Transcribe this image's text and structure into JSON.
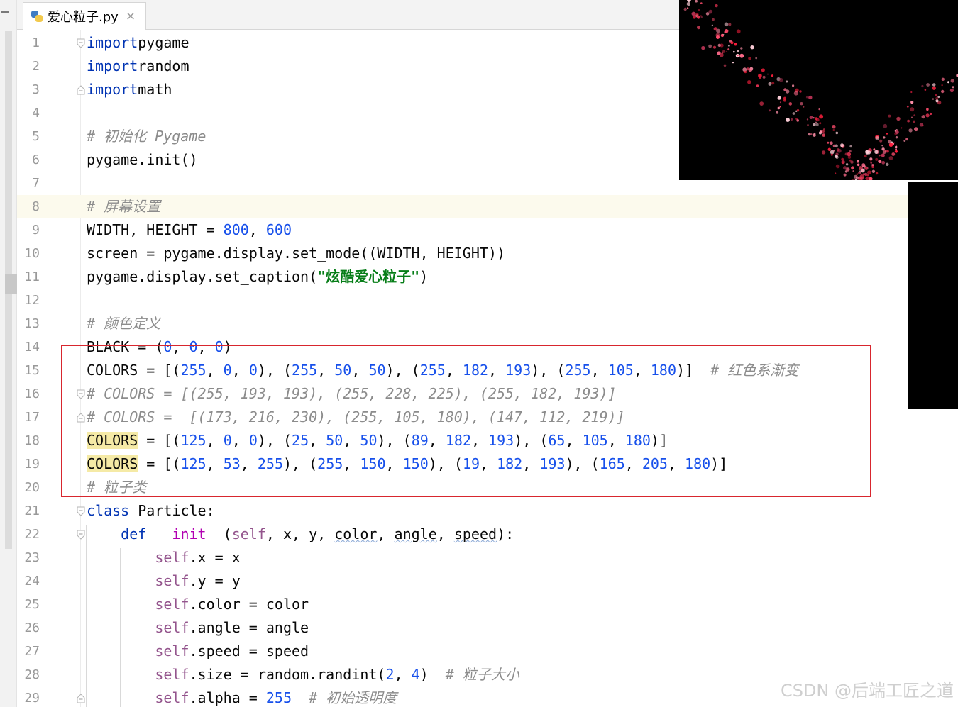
{
  "editor": {
    "tab": {
      "filename": "爱心粒子.py",
      "close": "×"
    },
    "watermark": "CSDN @后端工匠之道",
    "lines": [
      {
        "n": "1",
        "tokens": [
          [
            "kw",
            "import"
          ],
          [
            "",
            "pygame"
          ]
        ]
      },
      {
        "n": "2",
        "tokens": [
          [
            "kw",
            "import"
          ],
          [
            "",
            "random"
          ]
        ]
      },
      {
        "n": "3",
        "tokens": [
          [
            "kw",
            "import"
          ],
          [
            "",
            "math"
          ]
        ]
      },
      {
        "n": "4",
        "tokens": []
      },
      {
        "n": "5",
        "tokens": [
          [
            "cm",
            "# 初始化 Pygame"
          ]
        ]
      },
      {
        "n": "6",
        "tokens": [
          [
            "",
            "pygame.init()"
          ]
        ]
      },
      {
        "n": "7",
        "tokens": []
      },
      {
        "n": "8",
        "tokens": [
          [
            "cm",
            "# 屏幕设置"
          ]
        ],
        "current": true
      },
      {
        "n": "9",
        "tokens": [
          [
            "",
            "WIDTH, HEIGHT = "
          ],
          [
            "num",
            "800"
          ],
          [
            "",
            ", "
          ],
          [
            "num",
            "600"
          ]
        ]
      },
      {
        "n": "10",
        "tokens": [
          [
            "",
            "screen = pygame.display.set_mode((WIDTH, HEIGHT))"
          ]
        ]
      },
      {
        "n": "11",
        "tokens": [
          [
            "",
            "pygame.display.set_caption("
          ],
          [
            "str",
            "\"炫酷爱心粒子\""
          ],
          [
            "",
            ")"
          ]
        ]
      },
      {
        "n": "12",
        "tokens": []
      },
      {
        "n": "13",
        "tokens": [
          [
            "cm",
            "# 颜色定义"
          ]
        ]
      },
      {
        "n": "14",
        "tokens": [
          [
            "",
            "BLACK = ("
          ],
          [
            "num",
            "0"
          ],
          [
            "",
            ", "
          ],
          [
            "num",
            "0"
          ],
          [
            "",
            ", "
          ],
          [
            "num",
            "0"
          ],
          [
            "",
            ")"
          ]
        ]
      },
      {
        "n": "15",
        "tokens": [
          [
            "",
            "COLORS = [("
          ],
          [
            "num",
            "255"
          ],
          [
            "",
            ", "
          ],
          [
            "num",
            "0"
          ],
          [
            "",
            ", "
          ],
          [
            "num",
            "0"
          ],
          [
            "",
            "), ("
          ],
          [
            "num",
            "255"
          ],
          [
            "",
            ", "
          ],
          [
            "num",
            "50"
          ],
          [
            "",
            ", "
          ],
          [
            "num",
            "50"
          ],
          [
            "",
            "), ("
          ],
          [
            "num",
            "255"
          ],
          [
            "",
            ", "
          ],
          [
            "num",
            "182"
          ],
          [
            "",
            ", "
          ],
          [
            "num",
            "193"
          ],
          [
            "",
            "), ("
          ],
          [
            "num",
            "255"
          ],
          [
            "",
            ", "
          ],
          [
            "num",
            "105"
          ],
          [
            "",
            ", "
          ],
          [
            "num",
            "180"
          ],
          [
            "",
            ")]  "
          ],
          [
            "cm",
            "# 红色系渐变"
          ]
        ]
      },
      {
        "n": "16",
        "tokens": [
          [
            "cm",
            "# COLORS = [(255, 193, 193), (255, 228, 225), (255, 182, 193)]"
          ]
        ]
      },
      {
        "n": "17",
        "tokens": [
          [
            "cm",
            "# COLORS =  [(173, 216, 230), (255, 105, 180), (147, 112, 219)]"
          ]
        ]
      },
      {
        "n": "18",
        "tokens": [
          [
            "hl",
            "COLORS"
          ],
          [
            "",
            " = [("
          ],
          [
            "num",
            "125"
          ],
          [
            "",
            ", "
          ],
          [
            "num",
            "0"
          ],
          [
            "",
            ", "
          ],
          [
            "num",
            "0"
          ],
          [
            "",
            "), ("
          ],
          [
            "num",
            "25"
          ],
          [
            "",
            ", "
          ],
          [
            "num",
            "50"
          ],
          [
            "",
            ", "
          ],
          [
            "num",
            "50"
          ],
          [
            "",
            "), ("
          ],
          [
            "num",
            "89"
          ],
          [
            "",
            ", "
          ],
          [
            "num",
            "182"
          ],
          [
            "",
            ", "
          ],
          [
            "num",
            "193"
          ],
          [
            "",
            "), ("
          ],
          [
            "num",
            "65"
          ],
          [
            "",
            ", "
          ],
          [
            "num",
            "105"
          ],
          [
            "",
            ", "
          ],
          [
            "num",
            "180"
          ],
          [
            "",
            ")]"
          ]
        ]
      },
      {
        "n": "19",
        "tokens": [
          [
            "hl",
            "COLORS"
          ],
          [
            "",
            " = [("
          ],
          [
            "num",
            "125"
          ],
          [
            "",
            ", "
          ],
          [
            "num",
            "53"
          ],
          [
            "",
            ", "
          ],
          [
            "num",
            "255"
          ],
          [
            "",
            "), ("
          ],
          [
            "num",
            "255"
          ],
          [
            "",
            ", "
          ],
          [
            "num",
            "150"
          ],
          [
            "",
            ", "
          ],
          [
            "num",
            "150"
          ],
          [
            "",
            "), ("
          ],
          [
            "num",
            "19"
          ],
          [
            "",
            ", "
          ],
          [
            "num",
            "182"
          ],
          [
            "",
            ", "
          ],
          [
            "num",
            "193"
          ],
          [
            "",
            "), ("
          ],
          [
            "num",
            "165"
          ],
          [
            "",
            ", "
          ],
          [
            "num",
            "205"
          ],
          [
            "",
            ", "
          ],
          [
            "num",
            "180"
          ],
          [
            "",
            ")]"
          ]
        ]
      },
      {
        "n": "20",
        "tokens": [
          [
            "cm",
            "# 粒子类"
          ]
        ]
      },
      {
        "n": "21",
        "tokens": [
          [
            "kw",
            "class"
          ],
          [
            "",
            " Particle:"
          ]
        ]
      },
      {
        "n": "22",
        "tokens": [
          [
            "",
            "    "
          ],
          [
            "kw",
            "def"
          ],
          [
            "",
            " "
          ],
          [
            "fn",
            "__init__"
          ],
          [
            "",
            "("
          ],
          [
            "self",
            "self"
          ],
          [
            "",
            ", x, y, "
          ],
          [
            "squig",
            "color"
          ],
          [
            "",
            ", "
          ],
          [
            "squig",
            "angle"
          ],
          [
            "",
            ", "
          ],
          [
            "squig",
            "speed"
          ],
          [
            "",
            "):"
          ]
        ]
      },
      {
        "n": "23",
        "tokens": [
          [
            "",
            "        "
          ],
          [
            "self",
            "self"
          ],
          [
            "",
            ".x = x"
          ]
        ]
      },
      {
        "n": "24",
        "tokens": [
          [
            "",
            "        "
          ],
          [
            "self",
            "self"
          ],
          [
            "",
            ".y = y"
          ]
        ]
      },
      {
        "n": "25",
        "tokens": [
          [
            "",
            "        "
          ],
          [
            "self",
            "self"
          ],
          [
            "",
            ".color = color"
          ]
        ]
      },
      {
        "n": "26",
        "tokens": [
          [
            "",
            "        "
          ],
          [
            "self",
            "self"
          ],
          [
            "",
            ".angle = angle"
          ]
        ]
      },
      {
        "n": "27",
        "tokens": [
          [
            "",
            "        "
          ],
          [
            "self",
            "self"
          ],
          [
            "",
            ".speed = speed"
          ]
        ]
      },
      {
        "n": "28",
        "tokens": [
          [
            "",
            "        "
          ],
          [
            "self",
            "self"
          ],
          [
            "",
            ".size = random.randint("
          ],
          [
            "num",
            "2"
          ],
          [
            "",
            ", "
          ],
          [
            "num",
            "4"
          ],
          [
            "",
            ")  "
          ],
          [
            "cm",
            "# 粒子大小"
          ]
        ]
      },
      {
        "n": "29",
        "tokens": [
          [
            "",
            "        "
          ],
          [
            "self",
            "self"
          ],
          [
            "",
            ".alpha = "
          ],
          [
            "num",
            "255"
          ],
          [
            "",
            "  "
          ],
          [
            "cm",
            "# 初始透明度"
          ]
        ]
      }
    ]
  }
}
